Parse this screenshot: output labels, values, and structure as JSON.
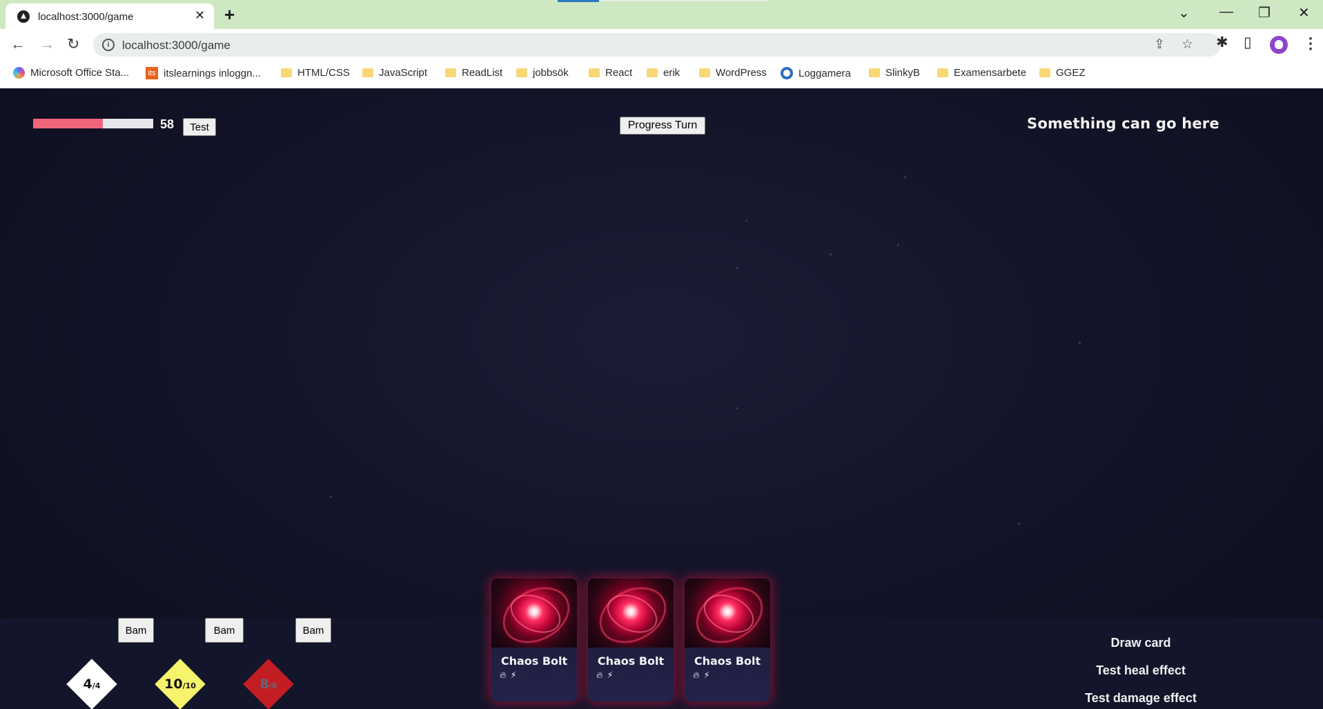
{
  "browser": {
    "tab_title": "localhost:3000/game",
    "url": "localhost:3000/game",
    "bookmarks": [
      "Microsoft Office Sta...",
      "itslearnings inloggn...",
      "HTML/CSS",
      "JavaScript",
      "ReadList",
      "jobbsök",
      "React",
      "erik",
      "WordPress",
      "Loggamera",
      "SlinkyB",
      "Examensarbete",
      "GGEZ"
    ]
  },
  "game": {
    "health": {
      "value": "58",
      "fraction": 0.58,
      "color": "#f0657b"
    },
    "test_button": "Test",
    "progress_turn_button": "Progress Turn",
    "top_right_text": "Something can go here",
    "resources": [
      {
        "current": "4",
        "max": "/4",
        "color": "#ffffff",
        "text_color": "#111111",
        "bam": "Bam"
      },
      {
        "current": "10",
        "max": "/10",
        "color": "#f6f36c",
        "text_color": "#111111",
        "bam": "Bam"
      },
      {
        "current": "8",
        "max": "/8",
        "color": "#c31d24",
        "text_color": "#5d6a7a",
        "bam": "Bam"
      }
    ],
    "hand": [
      {
        "name": "Chaos Bolt",
        "icons": [
          "fire-icon",
          "lightning-icon"
        ]
      },
      {
        "name": "Chaos Bolt",
        "icons": [
          "fire-icon",
          "lightning-icon"
        ]
      },
      {
        "name": "Chaos Bolt",
        "icons": [
          "fire-icon",
          "lightning-icon"
        ]
      }
    ],
    "actions": {
      "draw_card": "Draw card",
      "test_heal": "Test heal effect",
      "test_damage": "Test damage effect"
    }
  }
}
